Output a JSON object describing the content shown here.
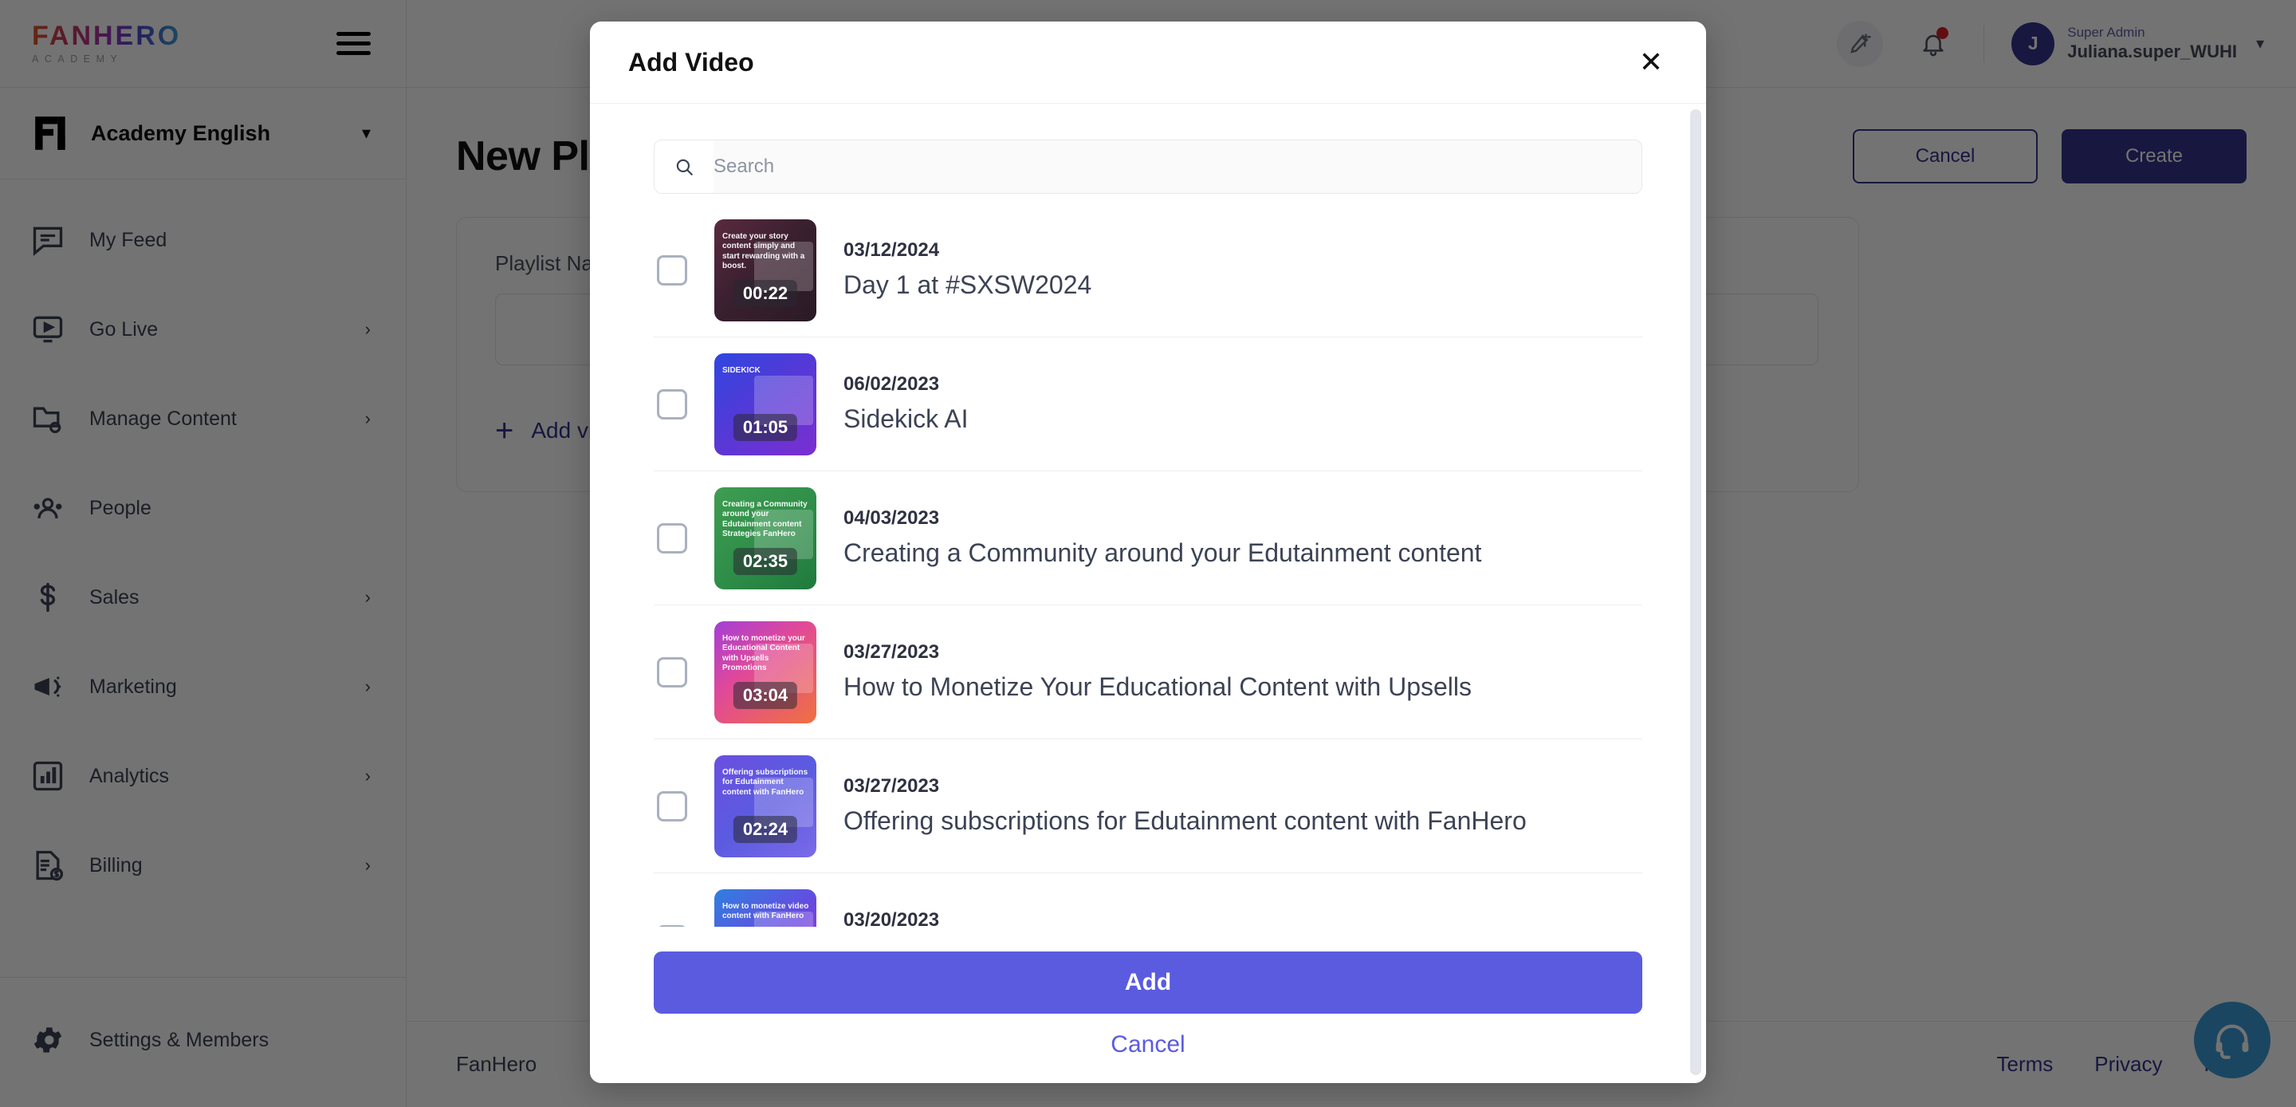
{
  "brand": {
    "logo_main": "FANHERO",
    "logo_sub": "ACADEMY"
  },
  "header": {
    "wand_icon": "magic-wand-icon",
    "bell_icon": "bell-icon",
    "user_role": "Super Admin",
    "user_name": "Juliana.super_WUHI",
    "avatar_initial": "J"
  },
  "sidebar": {
    "workspace_name": "Academy English",
    "items": [
      {
        "label": "My Feed",
        "icon": "feed-icon",
        "has_chevron": false
      },
      {
        "label": "Go Live",
        "icon": "live-icon",
        "has_chevron": true
      },
      {
        "label": "Manage Content",
        "icon": "folder-gear-icon",
        "has_chevron": true
      },
      {
        "label": "People",
        "icon": "people-icon",
        "has_chevron": false
      },
      {
        "label": "Sales",
        "icon": "dollar-icon",
        "has_chevron": true
      },
      {
        "label": "Marketing",
        "icon": "megaphone-icon",
        "has_chevron": true
      },
      {
        "label": "Analytics",
        "icon": "bar-chart-icon",
        "has_chevron": true
      },
      {
        "label": "Billing",
        "icon": "invoice-icon",
        "has_chevron": true
      }
    ],
    "bottom_item": {
      "label": "Settings & Members",
      "icon": "gear-icon"
    }
  },
  "page": {
    "title": "New Playlist",
    "cancel_label": "Cancel",
    "create_label": "Create",
    "playlist_name_label": "Playlist Name",
    "playlist_name_value": "",
    "add_video_label": "Add video"
  },
  "footer": {
    "brand": "FanHero",
    "links": [
      "Terms",
      "Privacy",
      "Help"
    ],
    "support_icon": "headset-icon"
  },
  "modal": {
    "title": "Add Video",
    "close_icon": "close-icon",
    "search": {
      "placeholder": "Search",
      "value": "",
      "icon": "search-icon"
    },
    "add_label": "Add",
    "cancel_label": "Cancel",
    "videos": [
      {
        "date": "03/12/2024",
        "title": "Day 1 at #SXSW2024",
        "duration": "00:22",
        "thumb_caption": "Create your story content simply and start rewarding with a boost.",
        "thumb_gradient": "linear-gradient(135deg,#5a2a3e 0%,#3b2030 45%,#2a1a24 100%)"
      },
      {
        "date": "06/02/2023",
        "title": "Sidekick AI",
        "duration": "01:05",
        "thumb_caption": "SIDEKICK",
        "thumb_gradient": "linear-gradient(140deg,#2f46e0 0%,#5b37d6 55%,#7b2fd0 100%)"
      },
      {
        "date": "04/03/2023",
        "title": "Creating a Community around your Edutainment content",
        "duration": "02:35",
        "thumb_caption": "Creating a Community around your Edutainment content Strategies FanHero",
        "thumb_gradient": "linear-gradient(140deg,#3e9d52 0%,#2e8d48 55%,#1f7a3c 100%)"
      },
      {
        "date": "03/27/2023",
        "title": "How to Monetize Your Educational Content with Upsells",
        "duration": "03:04",
        "thumb_caption": "How to monetize your Educational Content with Upsells Promotions",
        "thumb_gradient": "linear-gradient(140deg,#a33fd6 0%,#e0489a 40%,#f0713f 100%)"
      },
      {
        "date": "03/27/2023",
        "title": "Offering subscriptions for Edutainment content with FanHero",
        "duration": "02:24",
        "thumb_caption": "Offering subscriptions for Edutainment content with FanHero",
        "thumb_gradient": "linear-gradient(140deg,#6b4fe0 0%,#5b5be0 50%,#7a6ae8 100%)"
      },
      {
        "date": "03/20/2023",
        "title": "How to monetize video content with FanHero",
        "duration": "",
        "thumb_caption": "How to monetize video content with FanHero",
        "thumb_gradient": "linear-gradient(140deg,#2f7fe0 0%,#6b46e0 55%,#b93fd6 100%)"
      }
    ]
  },
  "colors": {
    "accent_purple": "#5b5be0",
    "brand_navy": "#33348e",
    "support_blue": "#3c9cd8",
    "notify_red": "#d61f26"
  }
}
